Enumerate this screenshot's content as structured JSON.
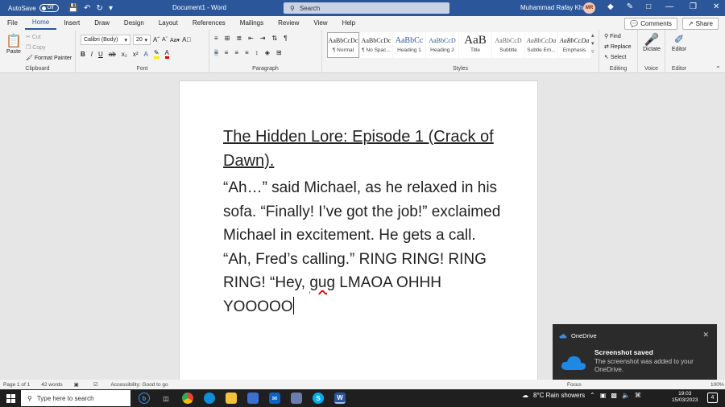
{
  "titlebar": {
    "autosave_label": "AutoSave",
    "autosave_state": "Off",
    "doc_title": "Document1  -  Word",
    "search_placeholder": "Search",
    "user_name": "Muhammad Rafay Khan",
    "user_initials": "MR"
  },
  "tabs": [
    "File",
    "Home",
    "Insert",
    "Draw",
    "Design",
    "Layout",
    "References",
    "Mailings",
    "Review",
    "View",
    "Help"
  ],
  "active_tab": "Home",
  "tab_actions": {
    "comments": "Comments",
    "share": "Share"
  },
  "ribbon": {
    "clipboard": {
      "label": "Clipboard",
      "paste": "Paste",
      "cut": "Cut",
      "copy": "Copy",
      "format_painter": "Format Painter"
    },
    "font": {
      "label": "Font",
      "font_name": "Calibri (Body)",
      "font_size": "20"
    },
    "paragraph": {
      "label": "Paragraph"
    },
    "styles": {
      "label": "Styles",
      "items": [
        {
          "sample": "AaBbCcDc",
          "name": "¶ Normal"
        },
        {
          "sample": "AaBbCcDc",
          "name": "¶ No Spac..."
        },
        {
          "sample": "AaBbCc",
          "name": "Heading 1"
        },
        {
          "sample": "AaBbCcD",
          "name": "Heading 2"
        },
        {
          "sample": "AaB",
          "name": "Title"
        },
        {
          "sample": "AaBbCcD",
          "name": "Subtitle"
        },
        {
          "sample": "AaBbCcDa",
          "name": "Subtle Em..."
        },
        {
          "sample": "AaBbCcDa",
          "name": "Emphasis"
        }
      ]
    },
    "editing": {
      "label": "Editing",
      "find": "Find",
      "replace": "Replace",
      "select": "Select"
    },
    "voice": {
      "label": "Voice",
      "dictate": "Dictate"
    },
    "editor": {
      "label": "Editor",
      "editor": "Editor"
    }
  },
  "document": {
    "heading": "The Hidden Lore: Episode 1 (Crack of Dawn).",
    "body_before": "“Ah…” said Michael, as he relaxed in his sofa. “Finally! I’ve got the job!” exclaimed Michael in excitement. He gets a call. “Ah, Fred’s calling.” RING RING! RING RING! “Hey, ",
    "misspelled": "gug",
    "body_after": " LMAOA OHHH YOOOOO"
  },
  "toast": {
    "app": "OneDrive",
    "title": "Screenshot saved",
    "message": "The screenshot was added to your OneDrive."
  },
  "statusbar": {
    "page": "Page 1 of 1",
    "words": "42 words",
    "accessibility": "Accessibility: Good to go",
    "focus": "Focus",
    "zoom": "100%"
  },
  "taskbar": {
    "search_placeholder": "Type here to search",
    "weather": "8°C  Rain showers",
    "time": "19:03",
    "date": "15/03/2023",
    "notifications": "4"
  },
  "colors": {
    "word_blue": "#2b579a",
    "toast_bg": "#2b2b2b",
    "taskbar": "#1f1f1f"
  }
}
